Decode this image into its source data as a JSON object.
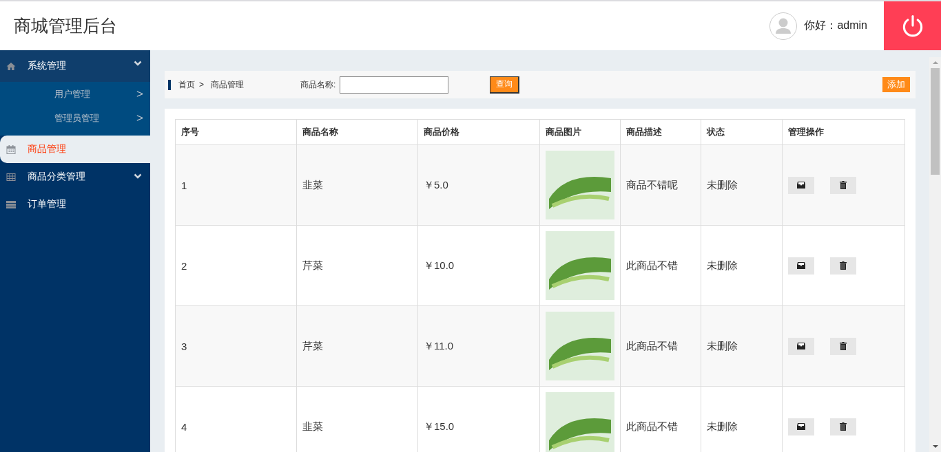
{
  "header": {
    "title": "商城管理后台",
    "greeting": "你好：admin"
  },
  "sidebar": {
    "items": [
      {
        "label": "系统管理",
        "selected": false,
        "expanded": true,
        "children": [
          {
            "label": "用户管理",
            "arrow": ">"
          },
          {
            "label": "管理员管理",
            "arrow": ">"
          }
        ]
      },
      {
        "label": "商品管理",
        "selected": true
      },
      {
        "label": "商品分类管理",
        "selected": false,
        "expanded": false
      },
      {
        "label": "订单管理",
        "selected": false
      }
    ]
  },
  "toolbar": {
    "breadcrumb": [
      "首页",
      "商品管理"
    ],
    "separator": ">",
    "search_label": "商品名称:",
    "search_button": "查询",
    "add_button": "添加"
  },
  "table": {
    "columns": [
      "序号",
      "商品名称",
      "商品价格",
      "商品图片",
      "商品描述",
      "状态",
      "管理操作"
    ],
    "rows": [
      {
        "index": "1",
        "name": "韭菜",
        "price": "￥5.0",
        "description": "商品不错呢",
        "status": "未删除"
      },
      {
        "index": "2",
        "name": "芹菜",
        "price": "￥10.0",
        "description": "此商品不错",
        "status": "未删除"
      },
      {
        "index": "3",
        "name": "芹菜",
        "price": "￥11.0",
        "description": "此商品不错",
        "status": "未删除"
      },
      {
        "index": "4",
        "name": "韭菜",
        "price": "￥15.0",
        "description": "此商品不错",
        "status": "未删除"
      }
    ]
  }
}
